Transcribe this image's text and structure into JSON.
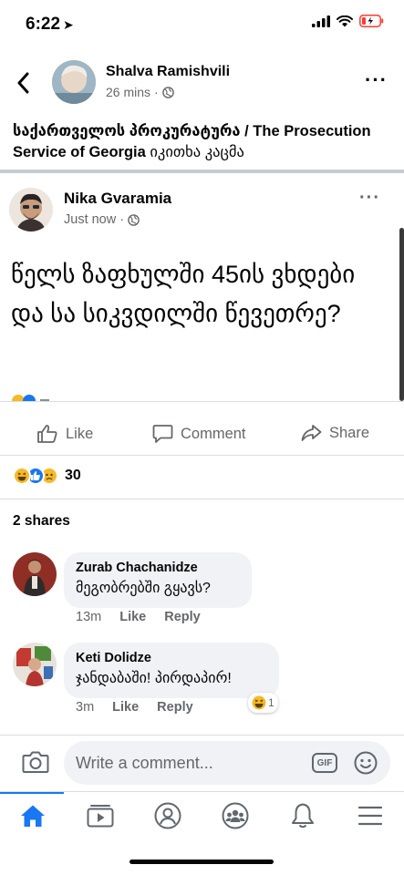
{
  "status_bar": {
    "time": "6:22",
    "battery_color": "#ff3b30"
  },
  "post": {
    "author": "Shalva Ramishvili",
    "time": "26 mins",
    "privacy": "public",
    "shared_text_bold": "საქართველოს პროკურატურა / The Prosecution Service of Georgia",
    "shared_text_rest": " იკითხა კაცმა"
  },
  "original_post": {
    "author": "Nika Gvaramia",
    "time": "Just now",
    "text": "წელს ზაფხულში 45ის ვხდები და სა სიკვდილში წევეთრე?"
  },
  "actions": {
    "like": "Like",
    "comment": "Comment",
    "share": "Share"
  },
  "reactions": {
    "count": "30",
    "types": [
      "haha",
      "like",
      "sad"
    ]
  },
  "shares": "2 shares",
  "comments": [
    {
      "name": "Zurab Chachanidze",
      "text": "მეგობრებში გყავს?",
      "time": "13m",
      "like": "Like",
      "reply": "Reply"
    },
    {
      "name": "Keti Dolidze",
      "text": "ჯანდაბაში! პირდაპირ!",
      "time": "3m",
      "like": "Like",
      "reply": "Reply",
      "reaction_count": "1"
    }
  ],
  "composer": {
    "placeholder": "Write a comment...",
    "gif": "GIF"
  },
  "tabs": [
    "home",
    "watch",
    "profile",
    "groups",
    "notifications",
    "menu"
  ],
  "colors": {
    "accent": "#1877f2",
    "secondary_text": "#65676b",
    "bubble": "#f0f2f5"
  }
}
